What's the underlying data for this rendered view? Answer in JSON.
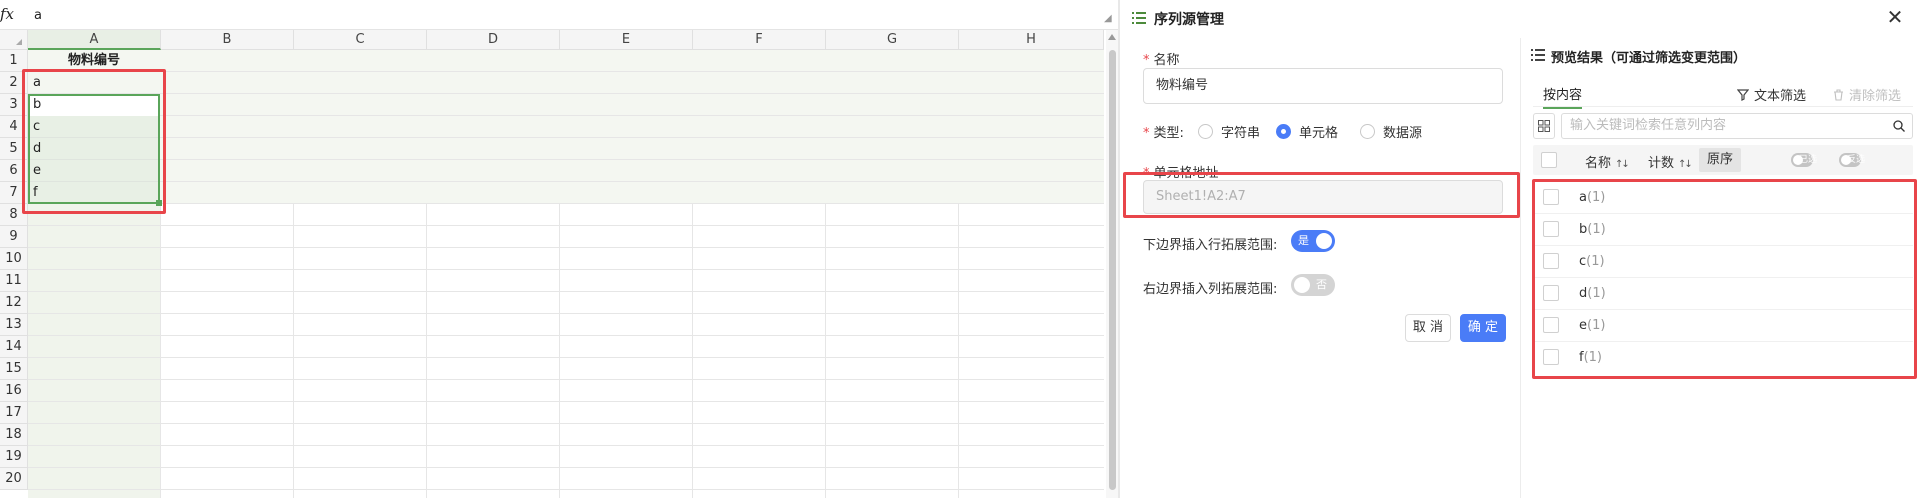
{
  "formula_bar": {
    "fx_label": "fx",
    "value": "a"
  },
  "sheet": {
    "columns": [
      "A",
      "B",
      "C",
      "D",
      "E",
      "F",
      "G",
      "H"
    ],
    "rows": [
      "1",
      "2",
      "3",
      "4",
      "5",
      "6",
      "7",
      "8",
      "9",
      "10",
      "11",
      "12",
      "13",
      "14",
      "15",
      "16",
      "17",
      "18",
      "19",
      "20"
    ],
    "header_cell": "物料编号",
    "values": [
      "a",
      "b",
      "c",
      "d",
      "e",
      "f"
    ]
  },
  "dialog": {
    "title": "序列源管理",
    "name_label": "名称",
    "name_value": "物料编号",
    "type_label": "类型:",
    "type_options": [
      "字符串",
      "单元格",
      "数据源"
    ],
    "type_selected": "单元格",
    "cell_address_label": "单元格地址",
    "cell_address_value": "Sheet1!A2:A7",
    "bottom_expand_label": "下边界插入行拓展范围:",
    "bottom_expand_state": "是",
    "right_expand_label": "右边界插入列拓展范围:",
    "right_expand_state": "否",
    "cancel_label": "取 消",
    "confirm_label": "确 定"
  },
  "preview": {
    "title": "预览结果（可通过筛选变更范围）",
    "tab_label": "按内容",
    "text_filter_label": "文本筛选",
    "clear_filter_label": "清除筛选",
    "search_placeholder": "输入关键词检索任意列内容",
    "col_name": "名称",
    "col_count": "计数",
    "order_label": "原序",
    "toggle_selected": "已选",
    "toggle_invert": "反选",
    "items": [
      {
        "name": "a",
        "count": "(1)"
      },
      {
        "name": "b",
        "count": "(1)"
      },
      {
        "name": "c",
        "count": "(1)"
      },
      {
        "name": "d",
        "count": "(1)"
      },
      {
        "name": "e",
        "count": "(1)"
      },
      {
        "name": "f",
        "count": "(1)"
      }
    ]
  },
  "colors": {
    "accent": "#4a7cf7",
    "selection_green": "#5aa55a",
    "highlight_red": "#e8454a"
  }
}
